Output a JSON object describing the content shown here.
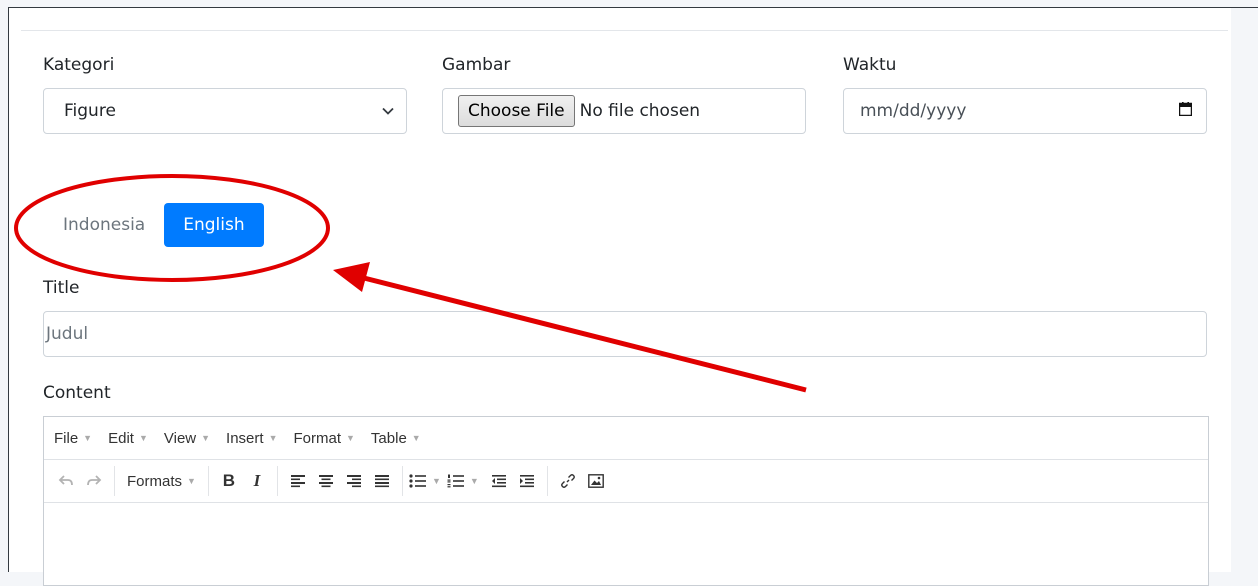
{
  "form": {
    "kategori": {
      "label": "Kategori",
      "value": "Figure"
    },
    "gambar": {
      "label": "Gambar",
      "button": "Choose File",
      "status": "No file chosen"
    },
    "waktu": {
      "label": "Waktu",
      "placeholder": "mm/dd/yyyy"
    }
  },
  "tabs": [
    {
      "label": "Indonesia",
      "active": false
    },
    {
      "label": "English",
      "active": true
    }
  ],
  "title_field": {
    "label": "Title",
    "placeholder": "Judul"
  },
  "content": {
    "label": "Content"
  },
  "editor": {
    "menus": [
      "File",
      "Edit",
      "View",
      "Insert",
      "Format",
      "Table"
    ],
    "formats_label": "Formats",
    "bold_label": "B",
    "italic_label": "I"
  },
  "colors": {
    "primary": "#007bff",
    "annotation": "#e00000"
  }
}
